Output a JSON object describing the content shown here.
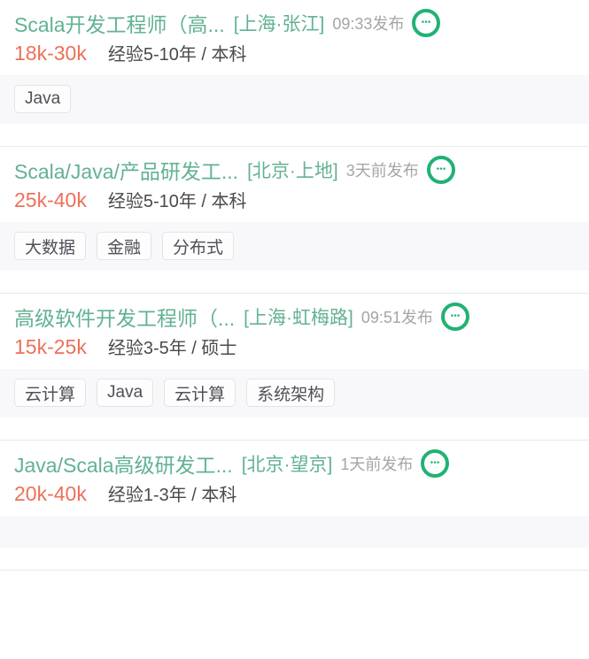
{
  "theme": {
    "title_color": "#62b292",
    "location_color": "#62b292",
    "time_color": "#a5a5a5",
    "salary_color": "#ec7159",
    "requirement_color": "#4a4a4a",
    "tag_band_bg": "#f8f7fa",
    "tag_border": "#e4e3e8",
    "divider_color": "#e9e9ed",
    "chat_icon_color": "#21b273"
  },
  "feed": {
    "jobs": [
      {
        "title": "Scala开发工程师（高...",
        "location": "[上海·张江]",
        "time": "09:33发布",
        "chat_icon": "chat-bubble-icon",
        "salary": "18k-30k",
        "requirement": "经验5-10年 / 本科",
        "tags": [
          "Java"
        ]
      },
      {
        "title": "Scala/Java/产品研发工...",
        "location": "[北京·上地]",
        "time": "3天前发布",
        "chat_icon": "chat-bubble-icon",
        "salary": "25k-40k",
        "requirement": "经验5-10年 / 本科",
        "tags": [
          "大数据",
          "金融",
          "分布式"
        ]
      },
      {
        "title": "高级软件开发工程师（...",
        "location": "[上海·虹梅路]",
        "time": "09:51发布",
        "chat_icon": "chat-bubble-icon",
        "salary": "15k-25k",
        "requirement": "经验3-5年 / 硕士",
        "tags": [
          "云计算",
          "Java",
          "云计算",
          "系统架构"
        ]
      },
      {
        "title": "Java/Scala高级研发工...",
        "location": "[北京·望京]",
        "time": "1天前发布",
        "chat_icon": "chat-bubble-icon",
        "salary": "20k-40k",
        "requirement": "经验1-3年 / 本科",
        "tags": []
      }
    ]
  }
}
